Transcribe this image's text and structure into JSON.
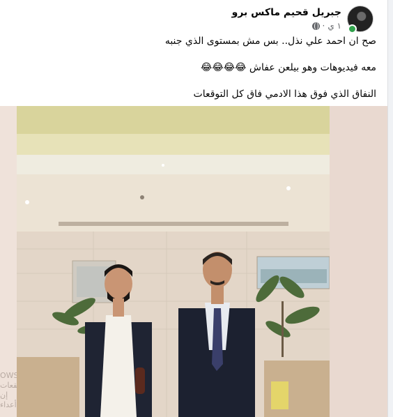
{
  "post": {
    "author": "جبريل قحيم ماكس برو",
    "time": "١ ي",
    "lines": [
      "صح ان احمد علي نذل.. بس مش بمستوى الذي جنبه",
      "معه فيديوهات وهو بيلعن عفاش 😂😂😂😂",
      "النفاق الذي فوق هذا الادمي فاق كل التوقعات"
    ]
  },
  "watermark": {
    "line1": "OWS",
    "line2": "ـقعات إن أعداء"
  },
  "colors": {
    "online": "#31a24c",
    "meta": "#65676b",
    "text": "#050505"
  }
}
